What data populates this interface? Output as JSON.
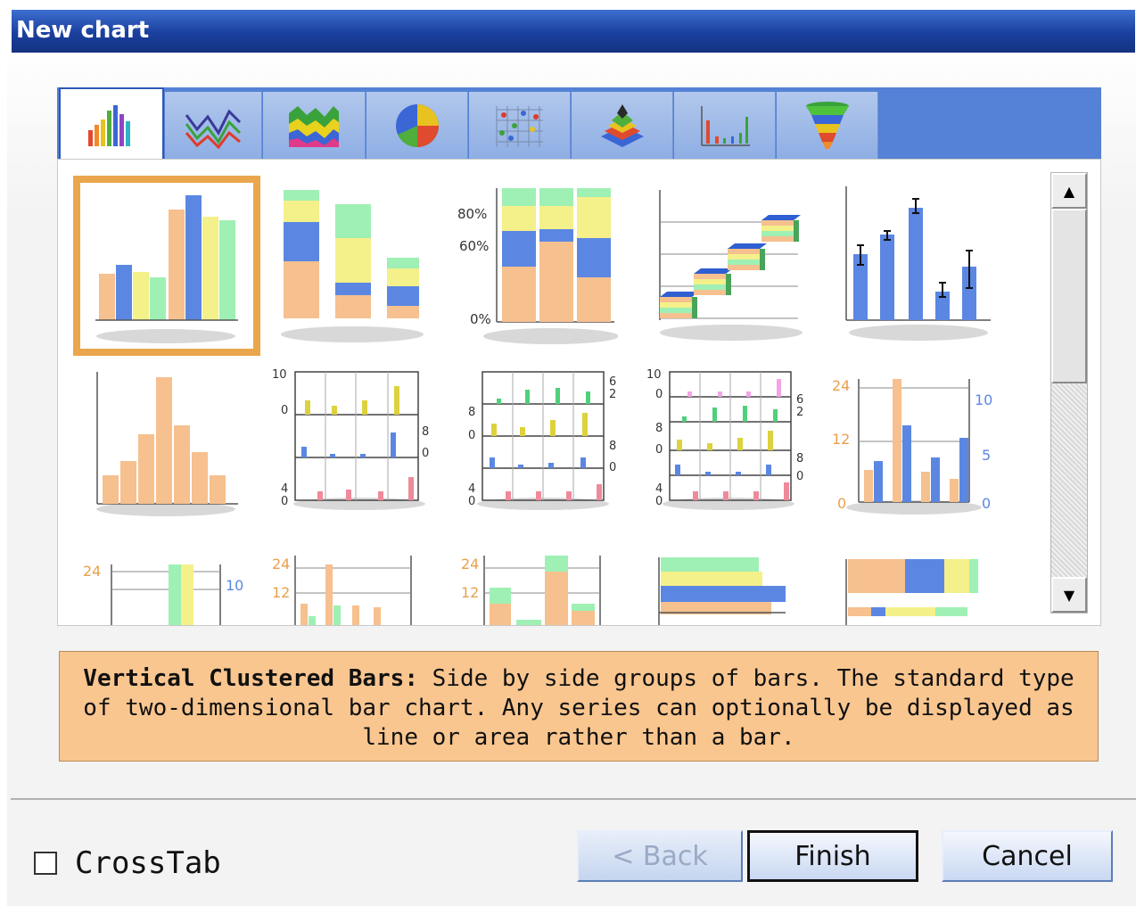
{
  "window": {
    "title": "New chart"
  },
  "tabs": [
    {
      "name": "bar-chart-tab",
      "active": true
    },
    {
      "name": "line-chart-tab",
      "active": false
    },
    {
      "name": "area-chart-tab",
      "active": false
    },
    {
      "name": "pie-chart-tab",
      "active": false
    },
    {
      "name": "scatter-chart-tab",
      "active": false
    },
    {
      "name": "3d-chart-tab",
      "active": false
    },
    {
      "name": "stock-chart-tab",
      "active": false
    },
    {
      "name": "funnel-chart-tab",
      "active": false
    }
  ],
  "thumbnail_labels": {
    "stacked_percent": {
      "p80": "80%",
      "p60": "60%",
      "p0": "0%"
    },
    "panel_a": {
      "t10": "10",
      "t0": "0",
      "r8": "8",
      "r0": "0",
      "b4": "4",
      "b0": "0"
    },
    "panel_b": {
      "r6": "6",
      "r2": "2",
      "l8": "8",
      "l0": "0",
      "r8": "8",
      "r0": "0",
      "b4": "4",
      "b0": "0"
    },
    "panel_c": {
      "t10": "10",
      "t0": "0",
      "r6": "6",
      "r2": "2",
      "l8": "8",
      "l0": "0",
      "r8": "8",
      "r0b": "0",
      "b4": "4",
      "b0": "0"
    },
    "dual_axis": {
      "l24": "24",
      "l12": "12",
      "l0": "0",
      "r10": "10",
      "r5": "5",
      "r0": "0"
    },
    "row3_a": {
      "l24": "24",
      "r10": "10"
    },
    "row3_b": {
      "l24": "24",
      "l12": "12"
    },
    "row3_c": {
      "l24": "24",
      "l12": "12"
    }
  },
  "description": {
    "title": "Vertical Clustered Bars:",
    "text": "Side by side groups of bars. The standard type of two-dimensional bar chart. Any series can optionally be displayed as line or area rather than a bar."
  },
  "crosstab": {
    "label": "CrossTab",
    "checked": false
  },
  "buttons": {
    "back": "< Back",
    "finish": "Finish",
    "cancel": "Cancel"
  },
  "colors": {
    "title_bar": "#1a3f9e",
    "tab_strip": "#5581d6",
    "selection": "#e9a64c",
    "description_bg": "#f9c690",
    "peach": "#f6c08f",
    "blue": "#5b87e3",
    "yellow": "#f4f08a",
    "green": "#9ff0b4",
    "pink": "#ee8a9a"
  }
}
